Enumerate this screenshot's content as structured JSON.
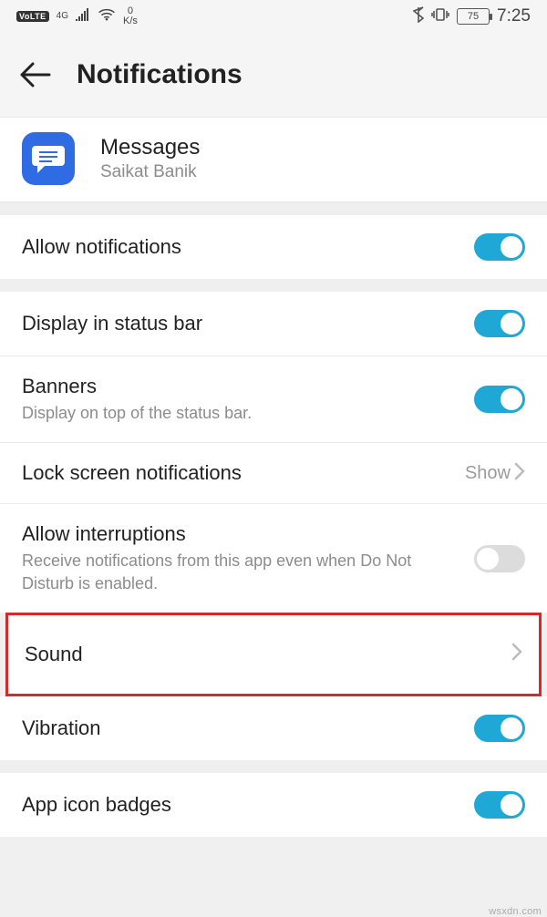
{
  "status": {
    "volte": "VoLTE",
    "network": "4G",
    "speed_top": "0",
    "speed_unit": "K/s",
    "battery": "75",
    "time": "7:25"
  },
  "header": {
    "title": "Notifications"
  },
  "app": {
    "name": "Messages",
    "account": "Saikat Banik"
  },
  "rows": {
    "allow_notifications": {
      "title": "Allow notifications",
      "on": true
    },
    "display_status_bar": {
      "title": "Display in status bar",
      "on": true
    },
    "banners": {
      "title": "Banners",
      "sub": "Display on top of the status bar.",
      "on": true
    },
    "lock_screen": {
      "title": "Lock screen notifications",
      "value": "Show"
    },
    "allow_interruptions": {
      "title": "Allow interruptions",
      "sub": "Receive notifications from this app even when Do Not Disturb is enabled.",
      "on": false
    },
    "sound": {
      "title": "Sound"
    },
    "vibration": {
      "title": "Vibration",
      "on": true
    },
    "badges": {
      "title": "App icon badges",
      "on": true
    }
  },
  "watermark": "wsxdn.com"
}
